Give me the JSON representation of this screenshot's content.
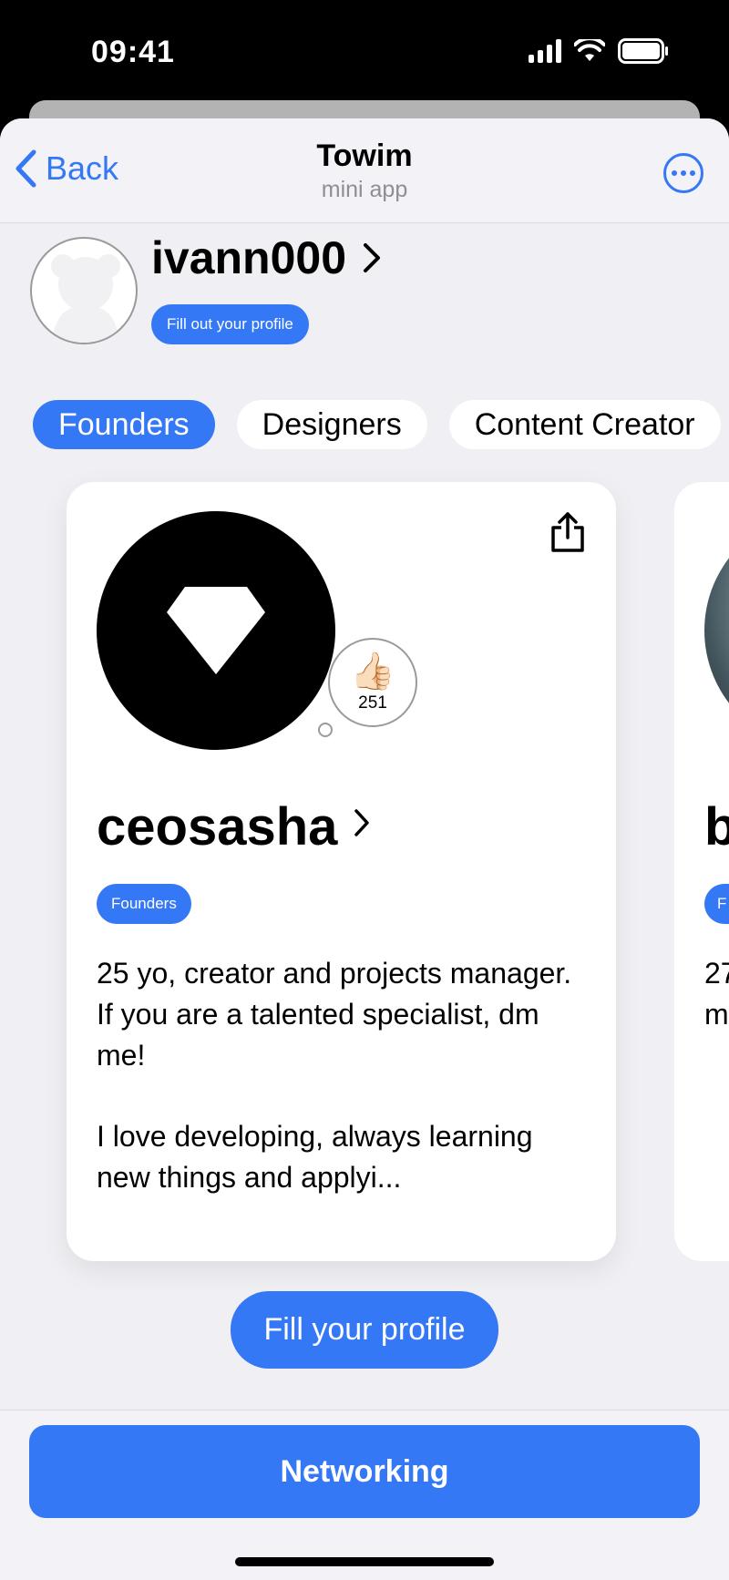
{
  "status_bar": {
    "time": "09:41"
  },
  "nav": {
    "back_label": "Back",
    "title": "Towim",
    "subtitle": "mini app",
    "more_icon": "ellipsis-circle-icon"
  },
  "user": {
    "username": "ivann000",
    "fill_chip": "Fill out your profile"
  },
  "tabs": [
    {
      "label": "Founders",
      "active": true
    },
    {
      "label": "Designers",
      "active": false
    },
    {
      "label": "Content Creator",
      "active": false
    }
  ],
  "card": {
    "name": "ceosasha",
    "tag": "Founders",
    "likes": "251",
    "like_emoji": "👍🏻",
    "bio": [
      "25 yo, creator and projects manager. If you are a talented specialist, dm me!",
      "I love developing, always learning new things and applyi..."
    ]
  },
  "next_card": {
    "name": "b",
    "tag": "F",
    "bio_lines": [
      "27",
      "m"
    ]
  },
  "fill_profile_button": "Fill your profile",
  "networking_button": "Networking",
  "colors": {
    "accent": "#3478f6",
    "background": "#efeff4",
    "card": "#ffffff"
  }
}
